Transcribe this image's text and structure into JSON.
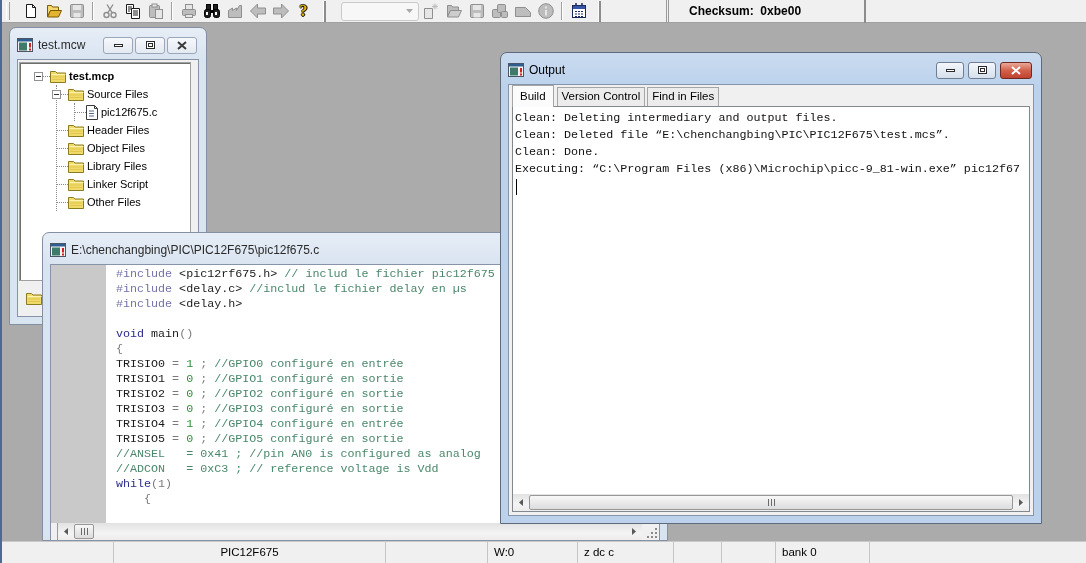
{
  "toolbar": {
    "buttons": [
      {
        "kind": "new",
        "disabled": false
      },
      {
        "kind": "open",
        "disabled": false
      },
      {
        "kind": "save",
        "disabled": true
      },
      {
        "kind": "separator"
      },
      {
        "kind": "cut",
        "disabled": true
      },
      {
        "kind": "copy",
        "disabled": false
      },
      {
        "kind": "paste",
        "disabled": true
      },
      {
        "kind": "separator"
      },
      {
        "kind": "print",
        "disabled": true
      },
      {
        "kind": "find",
        "disabled": false
      },
      {
        "kind": "stamp",
        "disabled": true
      },
      {
        "kind": "back",
        "disabled": true
      },
      {
        "kind": "forward",
        "disabled": true
      },
      {
        "kind": "help",
        "label": "?",
        "disabled": false
      },
      {
        "kind": "end"
      },
      {
        "kind": "combo",
        "disabled": true
      },
      {
        "kind": "sparkle",
        "disabled": true
      },
      {
        "kind": "open",
        "disabled": true
      },
      {
        "kind": "save",
        "disabled": true
      },
      {
        "kind": "cluster",
        "disabled": true
      },
      {
        "kind": "tag",
        "disabled": true
      },
      {
        "kind": "info",
        "disabled": true
      },
      {
        "kind": "separator"
      },
      {
        "kind": "calendar",
        "disabled": false
      },
      {
        "kind": "end"
      }
    ],
    "checksum": "Checksum:  0xbe00"
  },
  "project_window": {
    "title": "test.mcw",
    "active": false,
    "buttons": [
      {
        "kind": "minimize"
      },
      {
        "kind": "maximize"
      },
      {
        "kind": "close"
      }
    ],
    "tree": [
      {
        "label": "test.mcp",
        "kind": "folder",
        "expanded": true,
        "children": [
          {
            "label": "Source Files",
            "kind": "folder",
            "expanded": true,
            "children": [
              {
                "label": "pic12f675.c",
                "kind": "file"
              }
            ]
          },
          {
            "label": "Header Files",
            "kind": "folder"
          },
          {
            "label": "Object Files",
            "kind": "folder"
          },
          {
            "label": "Library Files",
            "kind": "folder"
          },
          {
            "label": "Linker Script",
            "kind": "folder"
          },
          {
            "label": "Other Files",
            "kind": "folder"
          }
        ]
      }
    ]
  },
  "editor_window": {
    "title": "E:\\chenchangbing\\PIC\\PIC12F675\\pic12f675.c",
    "active": false,
    "lines": [
      {
        "kind": "code",
        "tokens": [
          {
            "text": "#include",
            "kind": "directive"
          },
          {
            "text": " <pic12rf675.h>",
            "kind": "plain"
          },
          {
            "text": " // includ le fichier pic12f675",
            "kind": "comment"
          }
        ]
      },
      {
        "kind": "code",
        "tokens": [
          {
            "text": "#include",
            "kind": "directive"
          },
          {
            "text": " <delay.c>",
            "kind": "plain"
          },
          {
            "text": " //includ le fichier delay en µs",
            "kind": "comment"
          }
        ]
      },
      {
        "kind": "code",
        "tokens": [
          {
            "text": "#include",
            "kind": "directive"
          },
          {
            "text": " <delay.h>",
            "kind": "plain"
          }
        ]
      },
      {
        "kind": "blank"
      },
      {
        "kind": "code",
        "tokens": [
          {
            "text": "void",
            "kind": "keyword"
          },
          {
            "text": " main",
            "kind": "plain"
          },
          {
            "text": "()",
            "kind": "operator"
          }
        ]
      },
      {
        "kind": "code",
        "tokens": [
          {
            "text": "{",
            "kind": "operator"
          }
        ]
      },
      {
        "kind": "code",
        "tokens": [
          {
            "text": "TRISIO0",
            "kind": "plain"
          },
          {
            "text": " = ",
            "kind": "operator"
          },
          {
            "text": "1",
            "kind": "number"
          },
          {
            "text": " ; ",
            "kind": "operator"
          },
          {
            "text": "//GPIO0 configuré en entrée",
            "kind": "comment"
          }
        ]
      },
      {
        "kind": "code",
        "tokens": [
          {
            "text": "TRISIO1",
            "kind": "plain"
          },
          {
            "text": " = ",
            "kind": "operator"
          },
          {
            "text": "0",
            "kind": "number"
          },
          {
            "text": " ; ",
            "kind": "operator"
          },
          {
            "text": "//GPIO1 configuré en sortie",
            "kind": "comment"
          }
        ]
      },
      {
        "kind": "code",
        "tokens": [
          {
            "text": "TRISIO2",
            "kind": "plain"
          },
          {
            "text": " = ",
            "kind": "operator"
          },
          {
            "text": "0",
            "kind": "number"
          },
          {
            "text": " ; ",
            "kind": "operator"
          },
          {
            "text": "//GPIO2 configuré en sortie",
            "kind": "comment"
          }
        ]
      },
      {
        "kind": "code",
        "tokens": [
          {
            "text": "TRISIO3",
            "kind": "plain"
          },
          {
            "text": " = ",
            "kind": "operator"
          },
          {
            "text": "0",
            "kind": "number"
          },
          {
            "text": " ; ",
            "kind": "operator"
          },
          {
            "text": "//GPIO3 configuré en sortie",
            "kind": "comment"
          }
        ]
      },
      {
        "kind": "code",
        "tokens": [
          {
            "text": "TRISIO4",
            "kind": "plain"
          },
          {
            "text": " = ",
            "kind": "operator"
          },
          {
            "text": "1",
            "kind": "number"
          },
          {
            "text": " ; ",
            "kind": "operator"
          },
          {
            "text": "//GPIO4 configuré en entrée",
            "kind": "comment"
          }
        ]
      },
      {
        "kind": "code",
        "tokens": [
          {
            "text": "TRISIO5",
            "kind": "plain"
          },
          {
            "text": " = ",
            "kind": "operator"
          },
          {
            "text": "0",
            "kind": "number"
          },
          {
            "text": " ; ",
            "kind": "operator"
          },
          {
            "text": "//GPIO5 configuré en sortie",
            "kind": "comment"
          }
        ]
      },
      {
        "kind": "code",
        "tokens": [
          {
            "text": "//ANSEL   = 0x41 ; //pin AN0 is configured as analog",
            "kind": "comment"
          }
        ]
      },
      {
        "kind": "code",
        "tokens": [
          {
            "text": "//ADCON   = 0xC3 ; // reference voltage is Vdd",
            "kind": "comment"
          }
        ]
      },
      {
        "kind": "code",
        "tokens": [
          {
            "text": "while",
            "kind": "keyword"
          },
          {
            "text": "(1)",
            "kind": "operator"
          }
        ]
      },
      {
        "kind": "code",
        "tokens": [
          {
            "text": "    {",
            "kind": "operator"
          }
        ]
      }
    ]
  },
  "output_window": {
    "title": "Output",
    "active": true,
    "buttons": [
      {
        "kind": "minimize"
      },
      {
        "kind": "maximize"
      },
      {
        "kind": "close"
      }
    ],
    "tabs": [
      {
        "label": "Build",
        "selected": true
      },
      {
        "label": "Version Control",
        "selected": false
      },
      {
        "label": "Find in Files",
        "selected": false
      }
    ],
    "lines": [
      "Clean: Deleting intermediary and output files.",
      "Clean: Deleted file “E:\\chenchangbing\\PIC\\PIC12F675\\test.mcs”.",
      "Clean: Done.",
      "Executing: “C:\\Program Files (x86)\\Microchip\\picc-9_81-win.exe” pic12f67"
    ]
  },
  "status_bar": {
    "processor": "PIC12F675",
    "w_register": "W:0",
    "status_flags": "z dc c",
    "bank": "bank 0"
  }
}
